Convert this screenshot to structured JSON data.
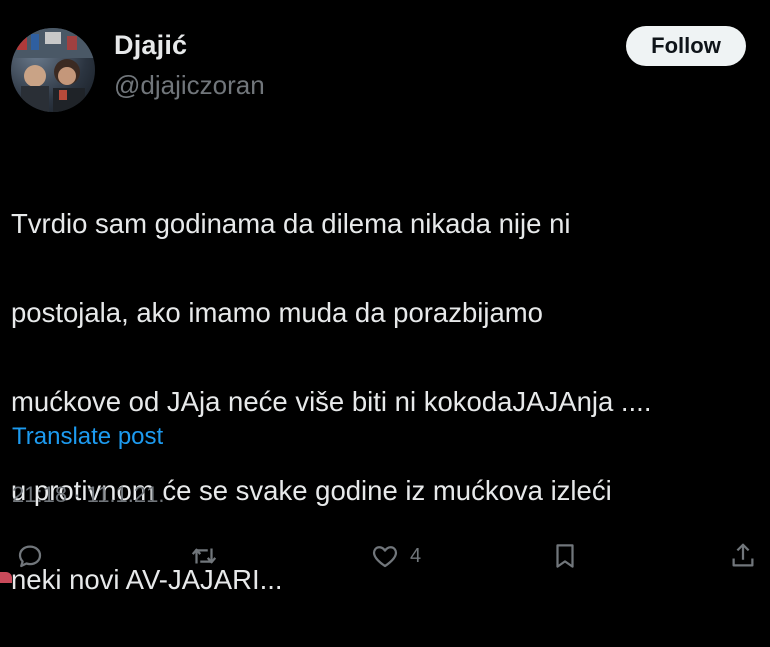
{
  "author": {
    "display_name": "Djajić",
    "handle": "@djajiczoran"
  },
  "follow_button": {
    "label": "Follow"
  },
  "tweet": {
    "lines": [
      "Tvrdio sam godinama da dilema nikada nije ni",
      "postojala, ako imamo muda da porazbijamo",
      "mućkove od JAja neće više biti ni kokodaJAJAnja ....",
      "u protivnom će se svake godine iz mućkova izlеći",
      "neki novi AV-JAJARI..."
    ],
    "translate_label": "Translate post",
    "timestamp": "21:18 · 11.1.21."
  },
  "actions": {
    "reply": {
      "icon": "reply-icon"
    },
    "repost": {
      "icon": "repost-icon"
    },
    "like": {
      "icon": "heart-icon",
      "count": "4"
    },
    "bookmark": {
      "icon": "bookmark-icon"
    },
    "share": {
      "icon": "share-icon"
    }
  },
  "colors": {
    "background": "#000000",
    "text": "#e7e9ea",
    "secondary": "#71767b",
    "link": "#1d9bf0",
    "follow_bg": "#eff3f4"
  }
}
